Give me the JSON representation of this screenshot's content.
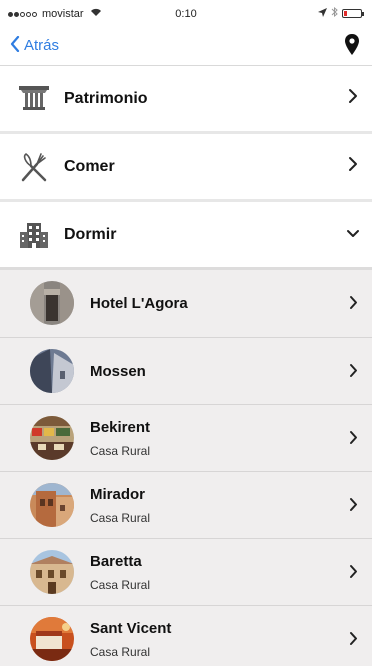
{
  "status_bar": {
    "carrier": "movistar",
    "time": "0:10"
  },
  "nav": {
    "back_label": "Atrás"
  },
  "categories": [
    {
      "label": "Patrimonio",
      "icon": "column-icon",
      "expanded": false
    },
    {
      "label": "Comer",
      "icon": "cutlery-icon",
      "expanded": false
    },
    {
      "label": "Dormir",
      "icon": "building-icon",
      "expanded": true
    }
  ],
  "hotels": [
    {
      "name": "Hotel L'Agora",
      "type": ""
    },
    {
      "name": "Mossen",
      "type": ""
    },
    {
      "name": "Bekirent",
      "type": "Casa Rural"
    },
    {
      "name": "Mirador",
      "type": "Casa Rural"
    },
    {
      "name": "Baretta",
      "type": "Casa Rural"
    },
    {
      "name": "Sant Vicent",
      "type": "Casa Rural"
    }
  ],
  "colors": {
    "accent": "#2f7de1",
    "list_background": "#f0eeee"
  }
}
